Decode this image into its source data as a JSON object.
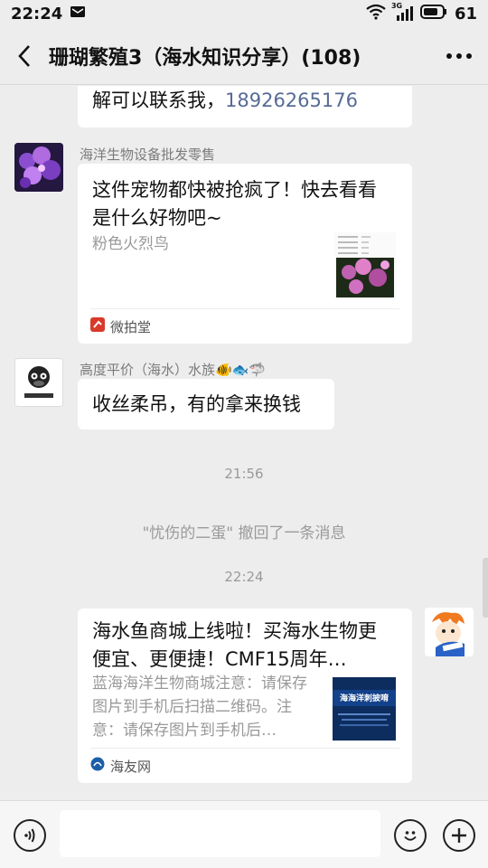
{
  "status": {
    "time": "22:24",
    "network": "3G",
    "battery": "61"
  },
  "header": {
    "title": "珊瑚繁殖3（海水知识分享）(108)"
  },
  "messages": {
    "partial": {
      "text": "解可以联系我，",
      "phone": "18926265176"
    },
    "card1": {
      "sender": "海洋生物设备批发零售",
      "title": "这件宠物都快被抢疯了！快去看看是什么好物吧~",
      "desc": "粉色火烈鸟",
      "source": "微拍堂"
    },
    "msg2": {
      "sender": "高度平价（海水）水族🐠🐟🦈",
      "text": "收丝柔吊，有的拿来换钱"
    },
    "time1": "21:56",
    "recall": "\"忧伤的二蛋\" 撤回了一条消息",
    "time2": "22:24",
    "card2": {
      "title": "海水鱼商城上线啦！买海水生物更便宜、更便捷！CMF15周年…",
      "desc": "蓝海海洋生物商城注意：请保存图片到手机后扫描二维码。注意：请保存图片到手机后…",
      "source": "海友网",
      "thumb_text": "海海洋刺披唷"
    }
  },
  "colors": {
    "link": "#576b95",
    "background": "#ededed"
  }
}
